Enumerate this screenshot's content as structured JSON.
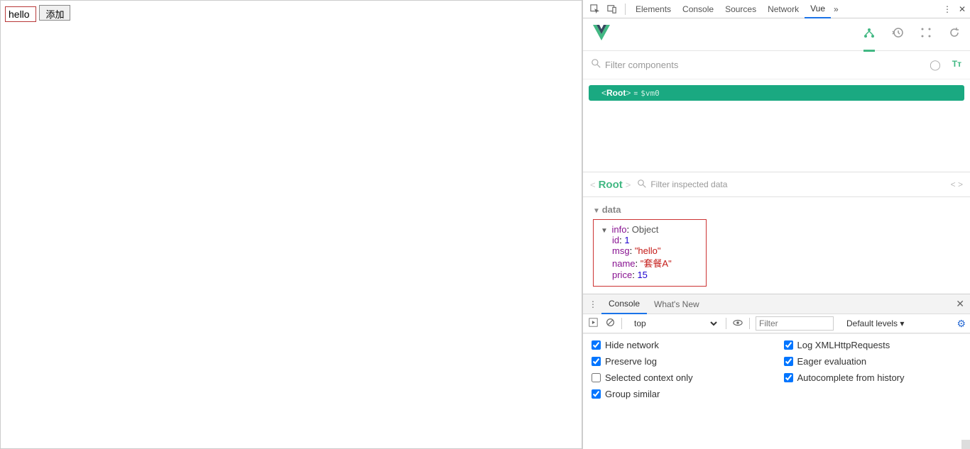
{
  "page": {
    "input_value": "hello",
    "add_button": "添加"
  },
  "devtools_tabs": {
    "elements": "Elements",
    "console": "Console",
    "sources": "Sources",
    "network": "Network",
    "vue": "Vue"
  },
  "vue": {
    "filter_placeholder": "Filter components",
    "root_label": "Root",
    "root_vm": "$vm0",
    "inspect_root": "Root",
    "inspect_filter_placeholder": "Filter inspected data",
    "data_section": "data",
    "info_label": "info",
    "info_type": "Object",
    "fields": {
      "id_key": "id",
      "id_val": "1",
      "msg_key": "msg",
      "msg_val": "\"hello\"",
      "name_key": "name",
      "name_val": "\"套餐A\"",
      "price_key": "price",
      "price_val": "15"
    }
  },
  "drawer": {
    "console": "Console",
    "whatsnew": "What's New"
  },
  "consolebar": {
    "context": "top",
    "filter_placeholder": "Filter",
    "levels": "Default levels ▾"
  },
  "settings": {
    "hide_network": "Hide network",
    "preserve_log": "Preserve log",
    "selected_context_only": "Selected context only",
    "group_similar": "Group similar",
    "log_xhr": "Log XMLHttpRequests",
    "eager_eval": "Eager evaluation",
    "autocomplete_history": "Autocomplete from history"
  }
}
